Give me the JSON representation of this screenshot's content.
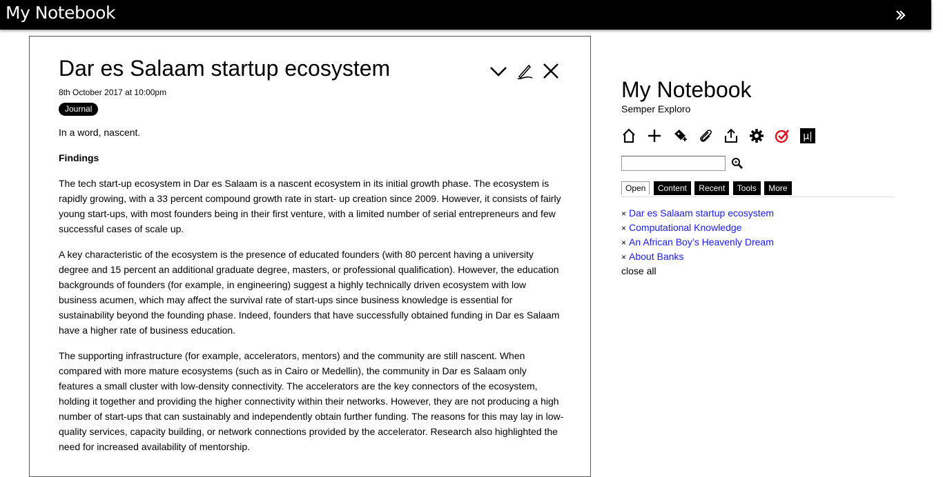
{
  "topbar": {
    "title": "My Notebook"
  },
  "tiddler": {
    "title": "Dar es Salaam startup ecosystem",
    "date": "8th October 2017 at 10:00pm",
    "tag": "Journal",
    "paragraphs": {
      "intro": "In a word, nascent.",
      "heading": "Findings",
      "p1": "The tech start-up ecosystem in Dar es Salaam is a nascent ecosystem in its initial growth phase. The ecosystem is rapidly growing, with a 33 percent compound growth rate in start- up creation since 2009. However, it consists of fairly young start-ups, with most founders being in their first venture, with a limited number of serial entrepreneurs and few successful cases of scale up.",
      "p2": "A key characteristic of the ecosystem is the presence of educated founders (with 80 percent having a university degree and 15 percent an additional graduate degree, masters, or professional qualification). However, the education backgrounds of founders (for example, in engineering) suggest a highly technically driven ecosystem with low business acumen, which may affect the survival rate of start-ups since business knowledge is essential for sustainability beyond the founding phase. Indeed, founders that have successfully obtained funding in Dar es Salaam have a higher rate of business education.",
      "p3": "The supporting infrastructure (for example, accelerators, mentors) and the community are still nascent. When compared with more mature ecosystems (such as in Cairo or Medellin), the community in Dar es Salaam only features a small cluster with low-density connectivity. The accelerators are the key connectors of the ecosystem, holding it together and providing the higher connectivity within their networks. However, they are not producing a high number of start-ups that can sustainably and independently obtain further funding. The reasons for this may lay in low-quality services, capacity building, or network connections provided by the accelerator. Research also highlighted the need for increased availability of mentorship."
    },
    "controls": [
      "chevron-down-icon",
      "edit-icon",
      "close-icon"
    ]
  },
  "sidebar": {
    "title": "My Notebook",
    "subtitle": "Semper Exploro",
    "toolbar_icons": [
      "home-icon",
      "plus-icon",
      "new-journal-icon",
      "paperclip-icon",
      "export-icon",
      "gear-icon",
      "check-circle-icon",
      "mu-icon"
    ],
    "search": {
      "value": "",
      "placeholder": ""
    },
    "tabs": {
      "open": "Open",
      "content": "Content",
      "recent": "Recent",
      "tools": "Tools",
      "more": "More"
    },
    "open_items": {
      "item1": "Dar es Salaam startup ecosystem",
      "item2": "Computational Knowledge",
      "item3": "An African Boy’s Heavenly Dream",
      "item4": "About Banks"
    },
    "close_symbol": "×",
    "close_all": "close all"
  },
  "colors": {
    "link": "#1a1ae6",
    "topbar": "#000000",
    "check_icon": "#e0141e"
  }
}
